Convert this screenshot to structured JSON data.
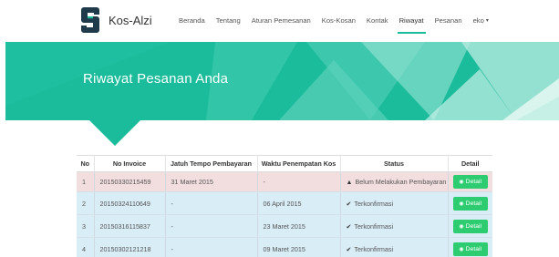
{
  "brand": {
    "name": "Kos-Alzi",
    "logo_icon": "s-logo-icon",
    "logo_color": "#1f3a4a"
  },
  "nav": {
    "items": [
      {
        "label": "Beranda",
        "active": false
      },
      {
        "label": "Tentang",
        "active": false
      },
      {
        "label": "Aturan Pemesanan",
        "active": false
      },
      {
        "label": "Kos-Kosan",
        "active": false
      },
      {
        "label": "Kontak",
        "active": false
      },
      {
        "label": "Riwayat",
        "active": true
      },
      {
        "label": "Pesanan",
        "active": false
      }
    ],
    "user": {
      "label": "eko",
      "caret": "▾"
    },
    "accent": "#1abc9c"
  },
  "hero": {
    "title": "Riwayat Pesanan Anda",
    "color": "#1abc9c"
  },
  "table": {
    "headers": [
      "No",
      "No Invoice",
      "Jatuh Tempo Pembayaran",
      "Waktu Penempatan Kos",
      "Status",
      "Detail"
    ],
    "rows": [
      {
        "no": "1",
        "invoice": "20150330215459",
        "due": "31 Maret 2015",
        "placement": "-",
        "status_icon": "warning-icon",
        "status_glyph": "▲",
        "status": "Belum Melakukan Pembayaran",
        "detail": "Detail",
        "state": "danger"
      },
      {
        "no": "2",
        "invoice": "20150324110649",
        "due": "-",
        "placement": "06 April 2015",
        "status_icon": "check-icon",
        "status_glyph": "✔",
        "status": "Terkonfirmasi",
        "detail": "Detail",
        "state": "info"
      },
      {
        "no": "3",
        "invoice": "20150316115837",
        "due": "-",
        "placement": "23 Maret 2015",
        "status_icon": "check-icon",
        "status_glyph": "✔",
        "status": "Terkonfirmasi",
        "detail": "Detail",
        "state": "info"
      },
      {
        "no": "4",
        "invoice": "20150302121218",
        "due": "-",
        "placement": "09 Maret 2015",
        "status_icon": "check-icon",
        "status_glyph": "✔",
        "status": "Terkonfirmasi",
        "detail": "Detail",
        "state": "info"
      }
    ],
    "detail_button_color": "#2ecc71",
    "detail_icon": "eye-icon"
  }
}
